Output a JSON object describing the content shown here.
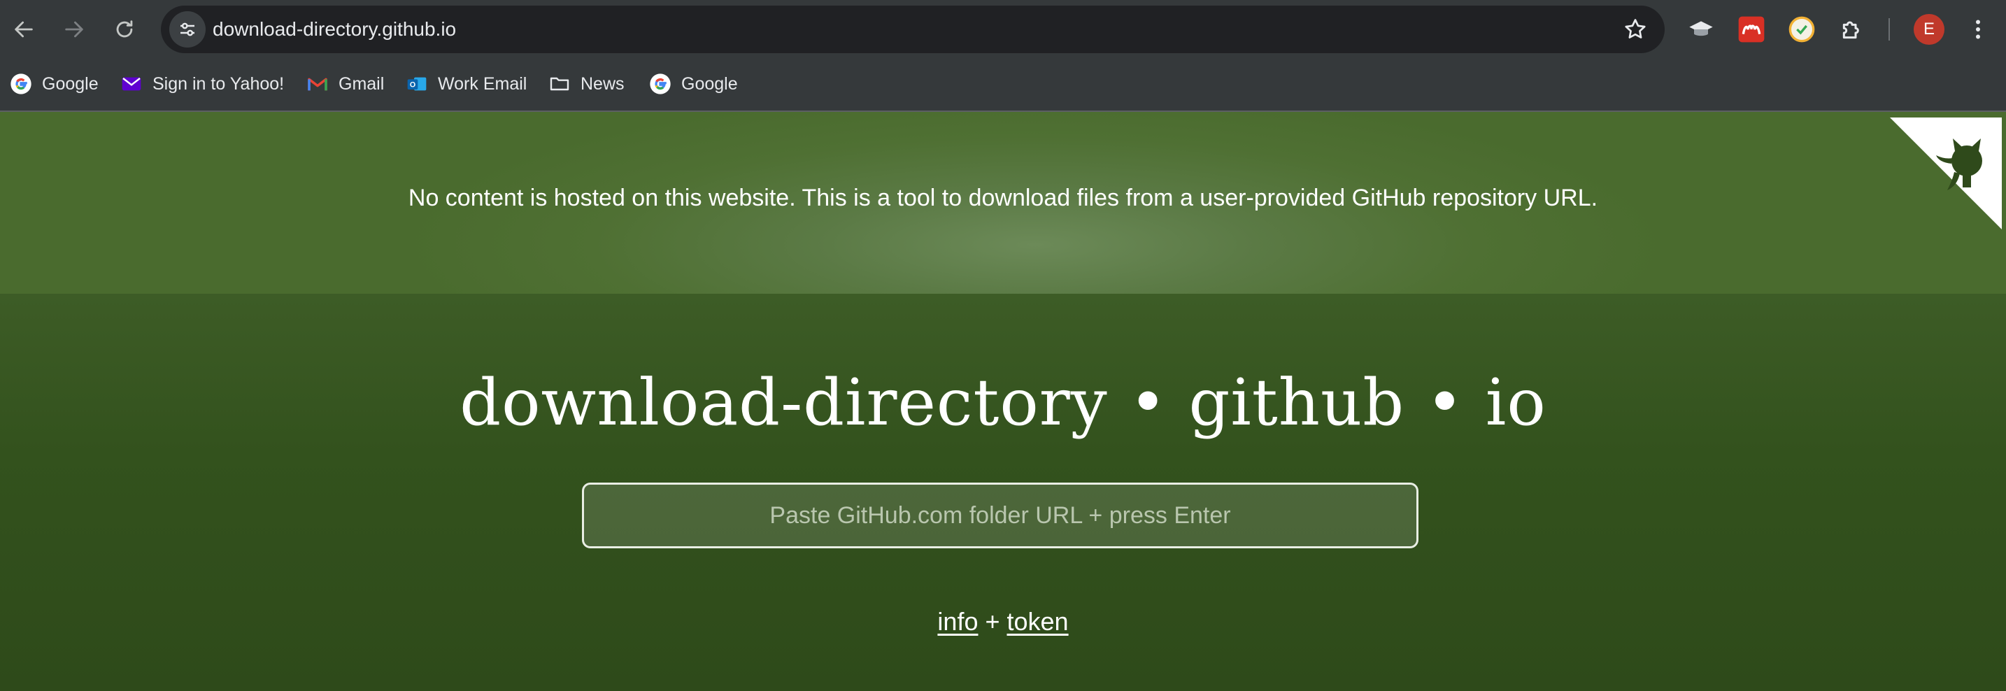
{
  "browser": {
    "url": "download-directory.github.io",
    "profile_initial": "E",
    "bookmarks": [
      {
        "label": "Google",
        "icon": "google-icon"
      },
      {
        "label": "Sign in to Yahoo!",
        "icon": "yahoo-mail-icon"
      },
      {
        "label": "Gmail",
        "icon": "gmail-icon"
      },
      {
        "label": "Work Email",
        "icon": "outlook-icon"
      },
      {
        "label": "News",
        "icon": "folder-icon"
      },
      {
        "label": "Google",
        "icon": "google-icon"
      }
    ],
    "extensions": [
      "graduation-cap-icon",
      "mendeley-icon",
      "clock-check-icon",
      "puzzle-piece-icon"
    ]
  },
  "page": {
    "notice": "No content is hosted on this website. This is a tool to download files from a user-provided GitHub repository URL.",
    "title": "download-directory • github • io",
    "input_placeholder": "Paste GitHub.com folder URL + press Enter",
    "links": {
      "info": "info",
      "separator": "+",
      "token": "token"
    }
  },
  "colors": {
    "banner": "#4f7033",
    "background": "#2f4a1b",
    "chrome": "#35393b",
    "omnibox": "#202124",
    "avatar": "#c0392b"
  }
}
